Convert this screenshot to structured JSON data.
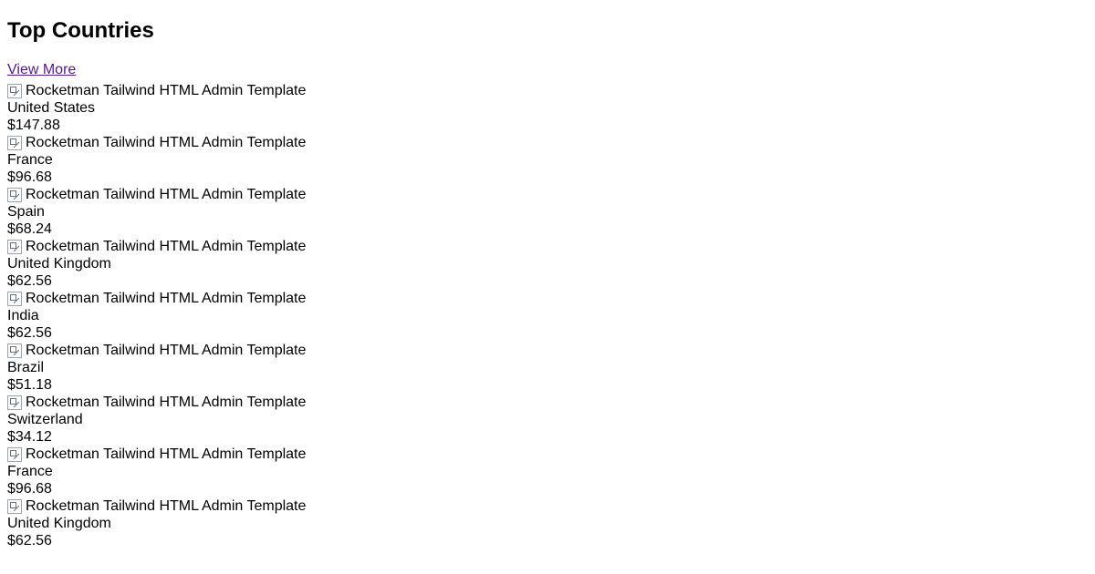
{
  "title": "Top Countries",
  "view_more": "View More",
  "img_alt": "Rocketman Tailwind HTML Admin Template",
  "countries": [
    {
      "name": "United States",
      "price": "$147.88"
    },
    {
      "name": "France",
      "price": "$96.68"
    },
    {
      "name": "Spain",
      "price": "$68.24"
    },
    {
      "name": "United Kingdom",
      "price": "$62.56"
    },
    {
      "name": "India",
      "price": "$62.56"
    },
    {
      "name": "Brazil",
      "price": "$51.18"
    },
    {
      "name": "Switzerland",
      "price": "$34.12"
    },
    {
      "name": "France",
      "price": "$96.68"
    },
    {
      "name": "United Kingdom",
      "price": "$62.56"
    }
  ]
}
